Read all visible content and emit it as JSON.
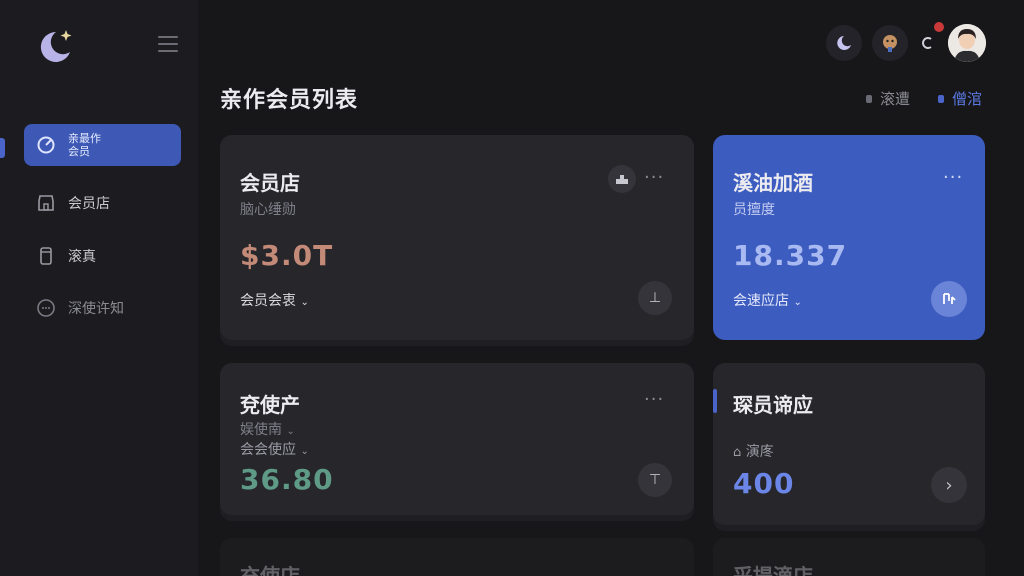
{
  "sidebar": {
    "items": [
      {
        "label": "亲最作\n会员",
        "icon": "chart-gauge-icon"
      },
      {
        "label": "会员店",
        "icon": "store-icon"
      },
      {
        "label": "滚真",
        "icon": "device-icon"
      },
      {
        "label": "深使许知",
        "icon": "chat-icon"
      }
    ]
  },
  "header": {
    "title": "亲作会员列表",
    "legend": [
      {
        "label": "滚遭"
      },
      {
        "label": "僧涫"
      }
    ]
  },
  "cards": [
    {
      "title": "会员店",
      "subtitle": "脑心缍勋",
      "value": "$3.0T",
      "link": "会员会衷",
      "value_color": "#c48a78"
    },
    {
      "title": "溪油加酒",
      "subtitle": "员擅度",
      "value": "18.337",
      "link": "会速应店",
      "value_color": "#a9baf2"
    },
    {
      "title": "兗使产",
      "subtitle": "娱使南",
      "link": "会会使应",
      "value": "36.80",
      "value_color": "#5f9a86"
    },
    {
      "title": "琛员谛应",
      "subtitle": "演庝",
      "value": "400",
      "value_color": "#6b86e6"
    },
    {
      "title": "充使店"
    },
    {
      "title": "采提滴店"
    }
  ],
  "colors": {
    "accent": "#3d5cc0",
    "background": "#17171a",
    "card": "#26262b"
  }
}
